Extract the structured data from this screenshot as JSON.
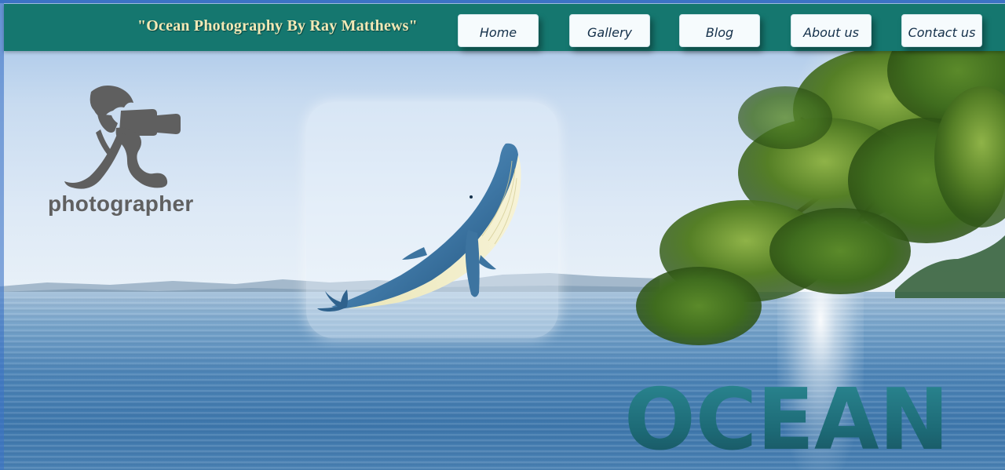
{
  "header": {
    "site_title": "\"Ocean Photography By Ray Matthews\""
  },
  "nav": {
    "items": [
      {
        "label": "Home"
      },
      {
        "label": "Gallery"
      },
      {
        "label": "Blog"
      },
      {
        "label": "About us"
      },
      {
        "label": "Contact us"
      }
    ]
  },
  "logo": {
    "text": "photographer",
    "icon": "photographer-with-camera-icon"
  },
  "hero": {
    "ocean_word": "OCEAN",
    "card_image": "whale-illustration"
  },
  "colors": {
    "header_bg": "#15776f",
    "title_color": "#f2e9b6",
    "button_bg": "#f6fbfd",
    "button_text": "#14304a",
    "ocean_text": "#1f6f7c"
  }
}
